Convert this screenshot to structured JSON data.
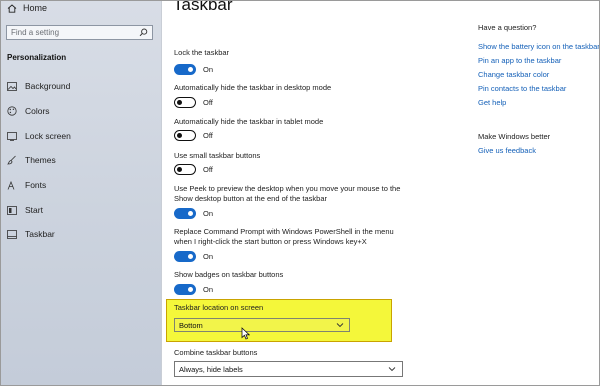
{
  "sidebar": {
    "home": "Home",
    "search_placeholder": "Find a setting",
    "section": "Personalization",
    "items": [
      {
        "label": "Background",
        "icon": "image-icon"
      },
      {
        "label": "Colors",
        "icon": "palette-icon"
      },
      {
        "label": "Lock screen",
        "icon": "lock-screen-icon"
      },
      {
        "label": "Themes",
        "icon": "brush-icon"
      },
      {
        "label": "Fonts",
        "icon": "font-icon"
      },
      {
        "label": "Start",
        "icon": "start-icon"
      },
      {
        "label": "Taskbar",
        "icon": "taskbar-icon"
      }
    ]
  },
  "main": {
    "title": "Taskbar",
    "settings": [
      {
        "label": "Lock the taskbar",
        "state": "On",
        "on": true
      },
      {
        "label": "Automatically hide the taskbar in desktop mode",
        "state": "Off",
        "on": false
      },
      {
        "label": "Automatically hide the taskbar in tablet mode",
        "state": "Off",
        "on": false
      },
      {
        "label": "Use small taskbar buttons",
        "state": "Off",
        "on": false
      },
      {
        "label_line1": "Use Peek to preview the desktop when you move your mouse to the",
        "label_line2": "Show desktop button at the end of the taskbar",
        "state": "On",
        "on": true
      },
      {
        "label_line1": "Replace Command Prompt with Windows PowerShell in the menu",
        "label_line2": "when I right-click the start button or press Windows key+X",
        "state": "On",
        "on": true
      },
      {
        "label": "Show badges on taskbar buttons",
        "state": "On",
        "on": true
      }
    ],
    "location": {
      "label": "Taskbar location on screen",
      "value": "Bottom"
    },
    "combine": {
      "label": "Combine taskbar buttons",
      "value": "Always, hide labels"
    }
  },
  "right_panel": {
    "question_heading": "Have a question?",
    "links": [
      "Show the battery icon on the taskbar",
      "Pin an app to the taskbar",
      "Change taskbar color",
      "Pin contacts to the taskbar",
      "Get help"
    ],
    "better_heading": "Make Windows better",
    "feedback_link": "Give us feedback"
  },
  "colors": {
    "accent": "#1769c9",
    "highlight": "#f4f73a",
    "link": "#1460b8"
  }
}
